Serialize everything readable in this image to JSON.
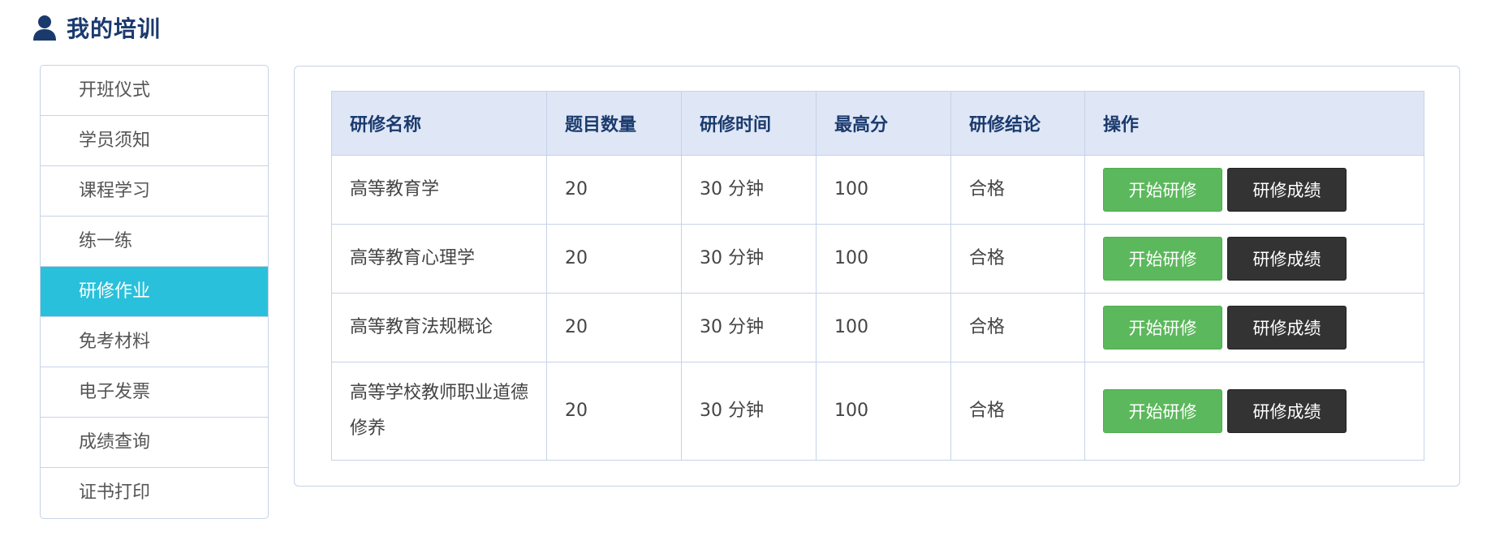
{
  "header": {
    "title": "我的培训",
    "icon": "user-icon"
  },
  "sidebar": {
    "items": [
      {
        "label": "开班仪式",
        "active": false
      },
      {
        "label": "学员须知",
        "active": false
      },
      {
        "label": "课程学习",
        "active": false
      },
      {
        "label": "练一练",
        "active": false
      },
      {
        "label": "研修作业",
        "active": true
      },
      {
        "label": "免考材料",
        "active": false
      },
      {
        "label": "电子发票",
        "active": false
      },
      {
        "label": "成绩查询",
        "active": false
      },
      {
        "label": "证书打印",
        "active": false
      }
    ]
  },
  "table": {
    "columns": [
      "研修名称",
      "题目数量",
      "研修时间",
      "最高分",
      "研修结论",
      "操作"
    ],
    "rows": [
      {
        "name": "高等教育学",
        "count": "20",
        "time": "30 分钟",
        "score": "100",
        "result": "合格",
        "start_label": "开始研修",
        "score_label": "研修成绩"
      },
      {
        "name": "高等教育心理学",
        "count": "20",
        "time": "30 分钟",
        "score": "100",
        "result": "合格",
        "start_label": "开始研修",
        "score_label": "研修成绩"
      },
      {
        "name": "高等教育法规概论",
        "count": "20",
        "time": "30 分钟",
        "score": "100",
        "result": "合格",
        "start_label": "开始研修",
        "score_label": "研修成绩"
      },
      {
        "name": "高等学校教师职业道德修养",
        "count": "20",
        "time": "30 分钟",
        "score": "100",
        "result": "合格",
        "start_label": "开始研修",
        "score_label": "研修成绩"
      }
    ]
  },
  "colors": {
    "accent": "#29c0db",
    "title": "#1a3a6e",
    "header_bg": "#dfe6f5",
    "border": "#c6d3e8",
    "btn_start": "#5cb85c",
    "btn_score": "#333333"
  }
}
